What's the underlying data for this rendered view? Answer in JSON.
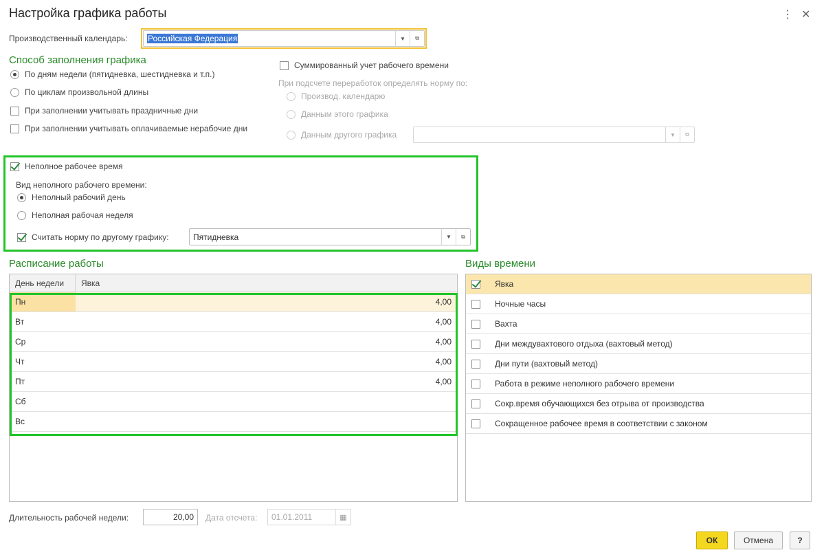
{
  "window": {
    "title": "Настройка графика работы",
    "more_icon": "more-vertical-icon",
    "close_icon": "close-icon"
  },
  "calendar": {
    "label": "Производственный календарь:",
    "value": "Российская Федерация"
  },
  "fill_method": {
    "title": "Способ заполнения графика",
    "by_weekdays": "По дням недели (пятидневка, шестидневка и т.п.)",
    "by_cycles": "По циклам произвольной длины",
    "consider_holidays": "При заполнении учитывать праздничные дни",
    "consider_paid_nonwork": "При заполнении учитывать оплачиваемые нерабочие дни"
  },
  "summarized": {
    "label": "Суммированный учет рабочего времени",
    "overtime_label": "При подсчете переработок определять норму по:",
    "opt_calendar": "Производ. календарю",
    "opt_this": "Данным этого графика",
    "opt_other": "Данным другого графика",
    "other_value": ""
  },
  "parttime": {
    "label": "Неполное рабочее время",
    "kind_label": "Вид неполного рабочего времени:",
    "day": "Неполный рабочий день",
    "week": "Неполная рабочая неделя",
    "norm_label": "Считать норму по другому графику:",
    "norm_value": "Пятидневка"
  },
  "schedule": {
    "title": "Расписание работы",
    "headers": {
      "day": "День недели",
      "value": "Явка"
    },
    "rows": [
      {
        "day": "Пн",
        "value": "4,00"
      },
      {
        "day": "Вт",
        "value": "4,00"
      },
      {
        "day": "Ср",
        "value": "4,00"
      },
      {
        "day": "Чт",
        "value": "4,00"
      },
      {
        "day": "Пт",
        "value": "4,00"
      },
      {
        "day": "Сб",
        "value": ""
      },
      {
        "day": "Вс",
        "value": ""
      }
    ]
  },
  "time_types": {
    "title": "Виды времени",
    "items": [
      {
        "label": "Явка",
        "checked": true
      },
      {
        "label": "Ночные часы",
        "checked": false
      },
      {
        "label": "Вахта",
        "checked": false
      },
      {
        "label": "Дни междувахтового отдыха (вахтовый метод)",
        "checked": false
      },
      {
        "label": "Дни пути (вахтовый метод)",
        "checked": false
      },
      {
        "label": "Работа в режиме неполного рабочего времени",
        "checked": false
      },
      {
        "label": "Сокр.время обучающихся без отрыва от производства",
        "checked": false
      },
      {
        "label": "Сокращенное рабочее время в соответствии с законом",
        "checked": false
      }
    ]
  },
  "footer": {
    "week_length_label": "Длительность рабочей недели:",
    "week_length_value": "20,00",
    "ref_date_label": "Дата отсчета:",
    "ref_date_value": "01.01.2011",
    "ok": "ОК",
    "cancel": "Отмена",
    "help": "?"
  }
}
